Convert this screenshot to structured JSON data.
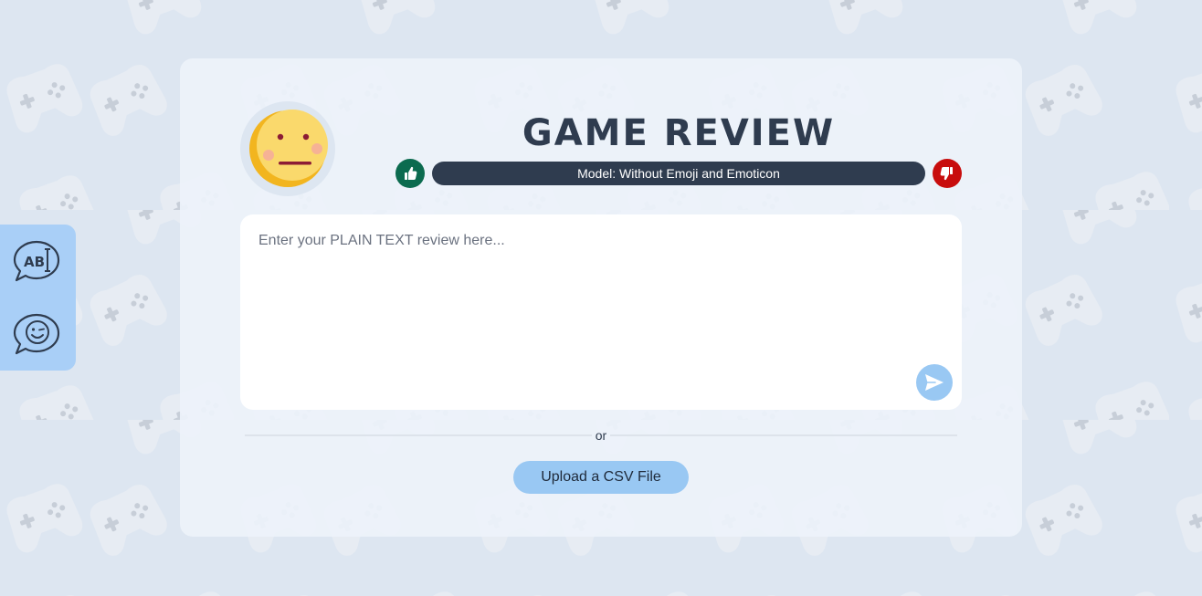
{
  "page": {
    "title": "Game Review"
  },
  "model_bar": {
    "label": "Model: Without Emoji and Emoticon"
  },
  "review": {
    "placeholder": "Enter your PLAIN TEXT review here...",
    "value": ""
  },
  "divider": {
    "text": "or"
  },
  "upload": {
    "label": "Upload a CSV File"
  },
  "side_panel": {
    "modes": [
      {
        "icon": "speech-bubble-text-icon",
        "glyph_text": "AB",
        "active": true
      },
      {
        "icon": "speech-bubble-smiley-icon",
        "active": false
      }
    ]
  },
  "avatar": {
    "icon": "neutral-face-emoji-icon"
  },
  "icons": {
    "thumbs_up": "thumbs-up-icon",
    "thumbs_down": "thumbs-down-icon",
    "send": "send-icon",
    "background": "gamepad-icon"
  },
  "colors": {
    "background": "#dde6f1",
    "card": "#edf2fa",
    "title": "#2f3c4f",
    "model_bar": "#2f3c4f",
    "thumbs_up": "#0b6b4f",
    "thumbs_down": "#c80d0d",
    "accent": "#99c8f3",
    "side_panel": "#a9cff7"
  }
}
